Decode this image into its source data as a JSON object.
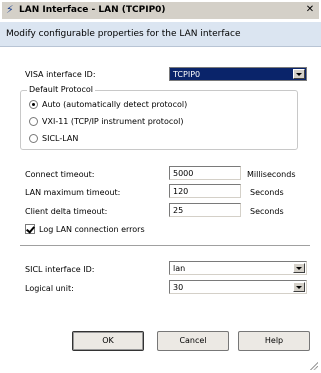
{
  "window": {
    "title": "LAN Interface - LAN (TCPIP0)",
    "close_glyph": "✕",
    "title_icon": "lan-interface-icon"
  },
  "description": "Modify configurable properties for the LAN interface",
  "visa": {
    "label": "VISA interface ID:",
    "value": "TCPIP0"
  },
  "protocol": {
    "legend": "Default Protocol",
    "options": [
      {
        "label": "Auto (automatically detect protocol)",
        "selected": true
      },
      {
        "label": "VXI-11 (TCP/IP instrument protocol)",
        "selected": false
      },
      {
        "label": "SICL-LAN",
        "selected": false
      }
    ]
  },
  "connect_timeout": {
    "label": "Connect timeout:",
    "value": "5000",
    "unit": "Milliseconds"
  },
  "lan_max_timeout": {
    "label": "LAN maximum timeout:",
    "value": "120",
    "unit": "Seconds"
  },
  "client_delta_timeout": {
    "label": "Client delta timeout:",
    "value": "25",
    "unit": "Seconds"
  },
  "log_errors": {
    "label": "Log LAN connection errors",
    "checked": true
  },
  "sicl": {
    "label": "SICL interface ID:",
    "value": "lan"
  },
  "logical_unit": {
    "label": "Logical unit:",
    "value": "30"
  },
  "buttons": {
    "ok": "OK",
    "cancel": "Cancel",
    "help": "Help"
  }
}
